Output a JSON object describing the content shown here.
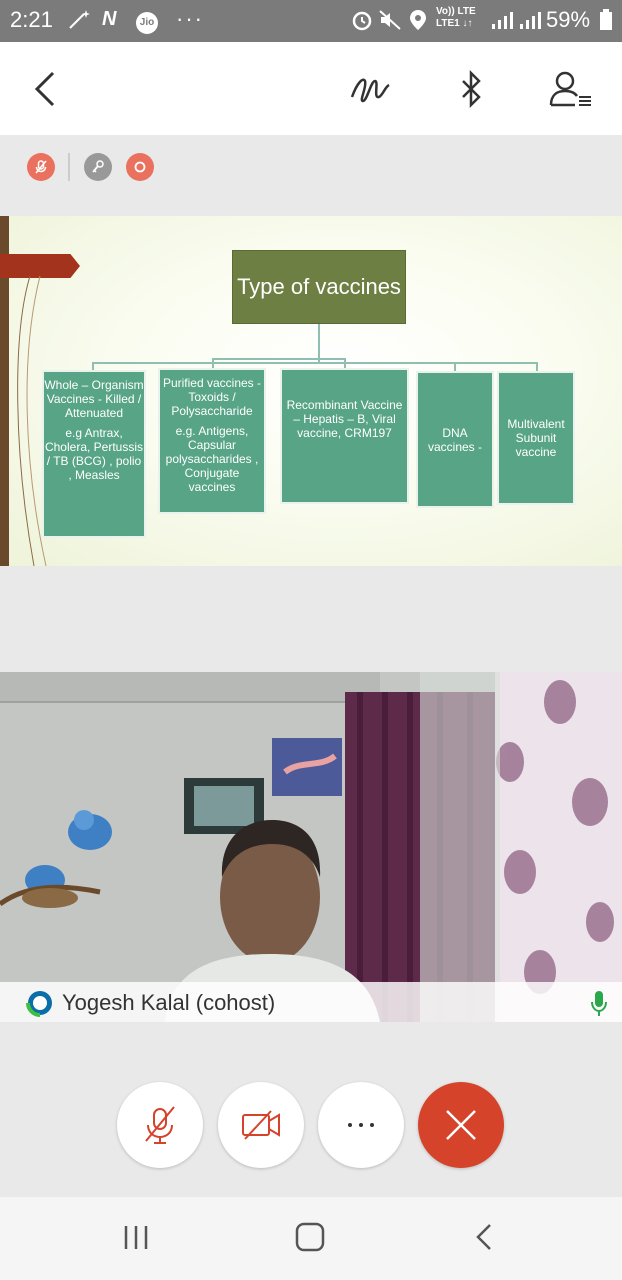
{
  "status_bar": {
    "time": "2:21",
    "carrier_badge": "Jio",
    "network_label_top": "Vo)) LTE",
    "network_label_bottom": "LTE1 ↓↑",
    "battery_percent": "59%"
  },
  "slide": {
    "title": "Type of vaccines",
    "boxes": [
      {
        "main": "Whole – Organism Vaccines  - Killed / Attenuated",
        "sub": "e.g Antrax, Cholera, Pertussis / TB (BCG) , polio , Measles"
      },
      {
        "main": "Purified vaccines  - Toxoids / Polysaccharide",
        "sub": "e.g. Antigens, Capsular polysaccharides , Conjugate vaccines"
      },
      {
        "main": "Recombinant Vaccine – Hepatis – B, Viral vaccine, CRM197",
        "sub": ""
      },
      {
        "main": "DNA vaccines -",
        "sub": ""
      },
      {
        "main": "Multivalent Subunit vaccine",
        "sub": ""
      }
    ]
  },
  "participant": {
    "name": "Yogesh Kalal (cohost)"
  },
  "icons": {
    "back": "chevron-left-icon",
    "annotate": "squiggle-icon",
    "bluetooth": "bluetooth-icon",
    "participants": "participant-list-icon",
    "mute_status": "mic-off-icon",
    "lock": "key-icon",
    "record": "record-icon",
    "mic": "microphone-icon",
    "mute": "mic-off-icon",
    "video": "video-off-icon",
    "more": "more-icon",
    "end": "close-icon"
  },
  "colors": {
    "accent_red": "#d5432b",
    "slide_title": "#6e7f44",
    "slide_box": "#58a487"
  }
}
